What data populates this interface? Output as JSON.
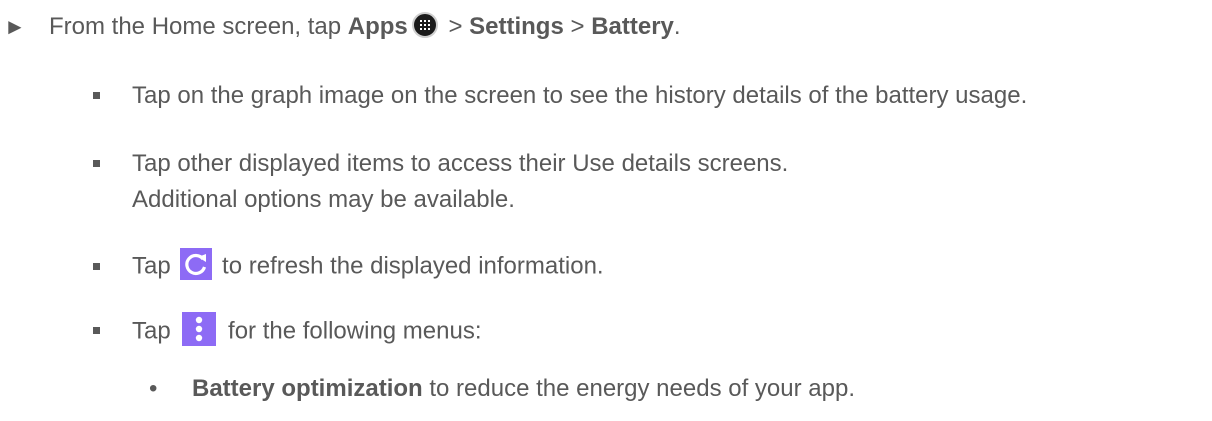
{
  "step": {
    "arrow": "►",
    "prefix": "From the Home screen, tap ",
    "apps_label": "Apps",
    "sep1": " > ",
    "settings_label": "Settings",
    "sep2": " > ",
    "battery_label": "Battery",
    "suffix": "."
  },
  "bullets": {
    "graph_tip": "Tap on the graph image on the screen to see the history details of the battery usage.",
    "other_items_tip": "Tap other displayed items to access their Use details screens. Additional options may be available.",
    "refresh_prefix": "Tap ",
    "refresh_suffix": " to refresh the displayed information.",
    "menu_prefix": "Tap ",
    "menu_suffix": " for the following menus:"
  },
  "submenu": {
    "dot": "•",
    "battery_optimization_label": "Battery optimization",
    "battery_optimization_desc": " to reduce the energy needs of  your app."
  },
  "icons": {
    "apps": "apps-grid-icon",
    "refresh": "refresh-icon",
    "menu": "more-vert-icon"
  },
  "colors": {
    "text": "#595959",
    "icon_accent": "#8d6bf5",
    "apps_icon_bg": "#1a1a1a"
  }
}
